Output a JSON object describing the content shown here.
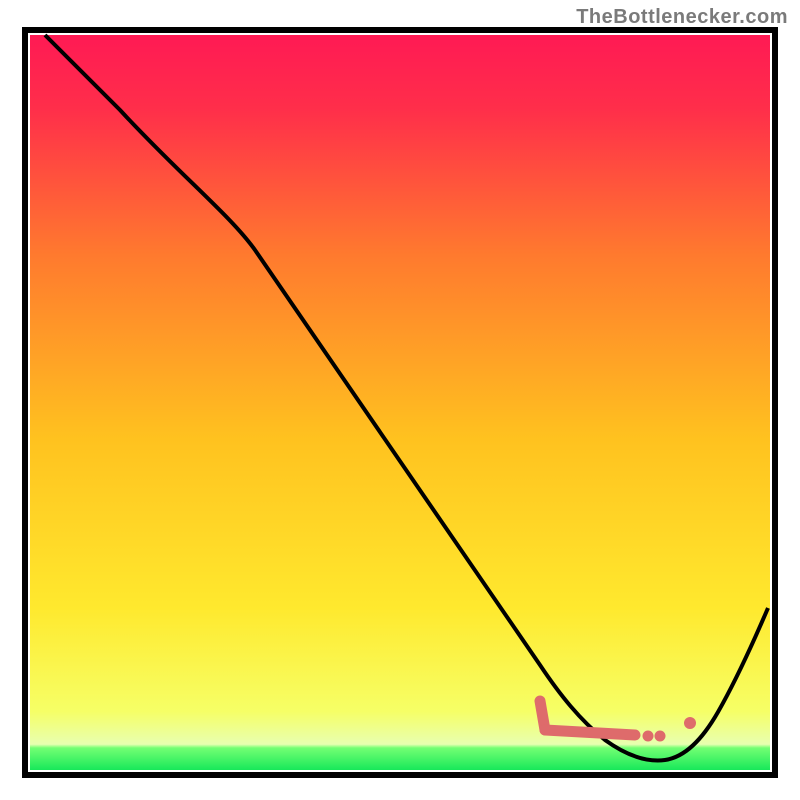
{
  "attribution": "TheBottlenecker.com",
  "chart_data": {
    "type": "line",
    "title": "",
    "xlabel": "",
    "ylabel": "",
    "xlim": [
      0,
      100
    ],
    "ylim": [
      0,
      100
    ],
    "grid": false,
    "series": [
      {
        "name": "bottleneck-curve",
        "color": "#000000",
        "x": [
          2,
          10,
          20,
          30,
          40,
          50,
          60,
          67,
          70,
          74,
          78,
          82,
          86,
          90,
          94,
          98
        ],
        "y": [
          100,
          88,
          76,
          66,
          54,
          42,
          30,
          20,
          14,
          8,
          3,
          0,
          1,
          6,
          14,
          26
        ]
      }
    ],
    "highlight_segment": {
      "name": "highlighted-range",
      "color": "#de6b6b",
      "x": [
        67,
        68,
        70,
        74,
        78,
        80,
        82,
        84
      ],
      "y": [
        9,
        5,
        4,
        3,
        3,
        3.5,
        4,
        6
      ]
    },
    "background_gradient": {
      "top_color": "#ff1a54",
      "mid_color": "#ffd400",
      "green_band_color": "#2fff5a",
      "green_band_y_range": [
        0,
        4
      ]
    }
  }
}
